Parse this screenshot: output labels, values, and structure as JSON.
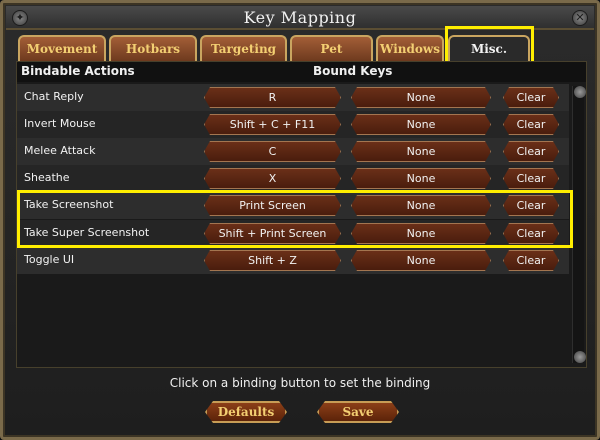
{
  "window": {
    "title": "Key Mapping"
  },
  "tabs": [
    {
      "label": "Movement",
      "active": false
    },
    {
      "label": "Hotbars",
      "active": false
    },
    {
      "label": "Targeting",
      "active": false
    },
    {
      "label": "Pet",
      "active": false
    },
    {
      "label": "Windows",
      "active": false
    },
    {
      "label": "Misc.",
      "active": true
    }
  ],
  "table": {
    "headers": {
      "actions": "Bindable Actions",
      "keys": "Bound Keys"
    },
    "rows": [
      {
        "action": "Chat Reply",
        "primary": "R",
        "secondary": "None",
        "clear": "Clear"
      },
      {
        "action": "Invert Mouse",
        "primary": "Shift + C + F11",
        "secondary": "None",
        "clear": "Clear"
      },
      {
        "action": "Melee Attack",
        "primary": "C",
        "secondary": "None",
        "clear": "Clear"
      },
      {
        "action": "Sheathe",
        "primary": "X",
        "secondary": "None",
        "clear": "Clear"
      },
      {
        "action": "Take Screenshot",
        "primary": "Print Screen",
        "secondary": "None",
        "clear": "Clear"
      },
      {
        "action": "Take Super Screenshot",
        "primary": "Shift + Print Screen",
        "secondary": "None",
        "clear": "Clear"
      },
      {
        "action": "Toggle UI",
        "primary": "Shift + Z",
        "secondary": "None",
        "clear": "Clear"
      }
    ]
  },
  "footer": {
    "hint": "Click on a binding button to set the binding",
    "defaults_label": "Defaults",
    "save_label": "Save"
  },
  "colors": {
    "highlight": "#ffee00",
    "tab_gold": "#f3cf72",
    "button_red": "#6a2f18"
  },
  "icons": {
    "corner_left": "gear-icon",
    "corner_right": "close-icon"
  }
}
